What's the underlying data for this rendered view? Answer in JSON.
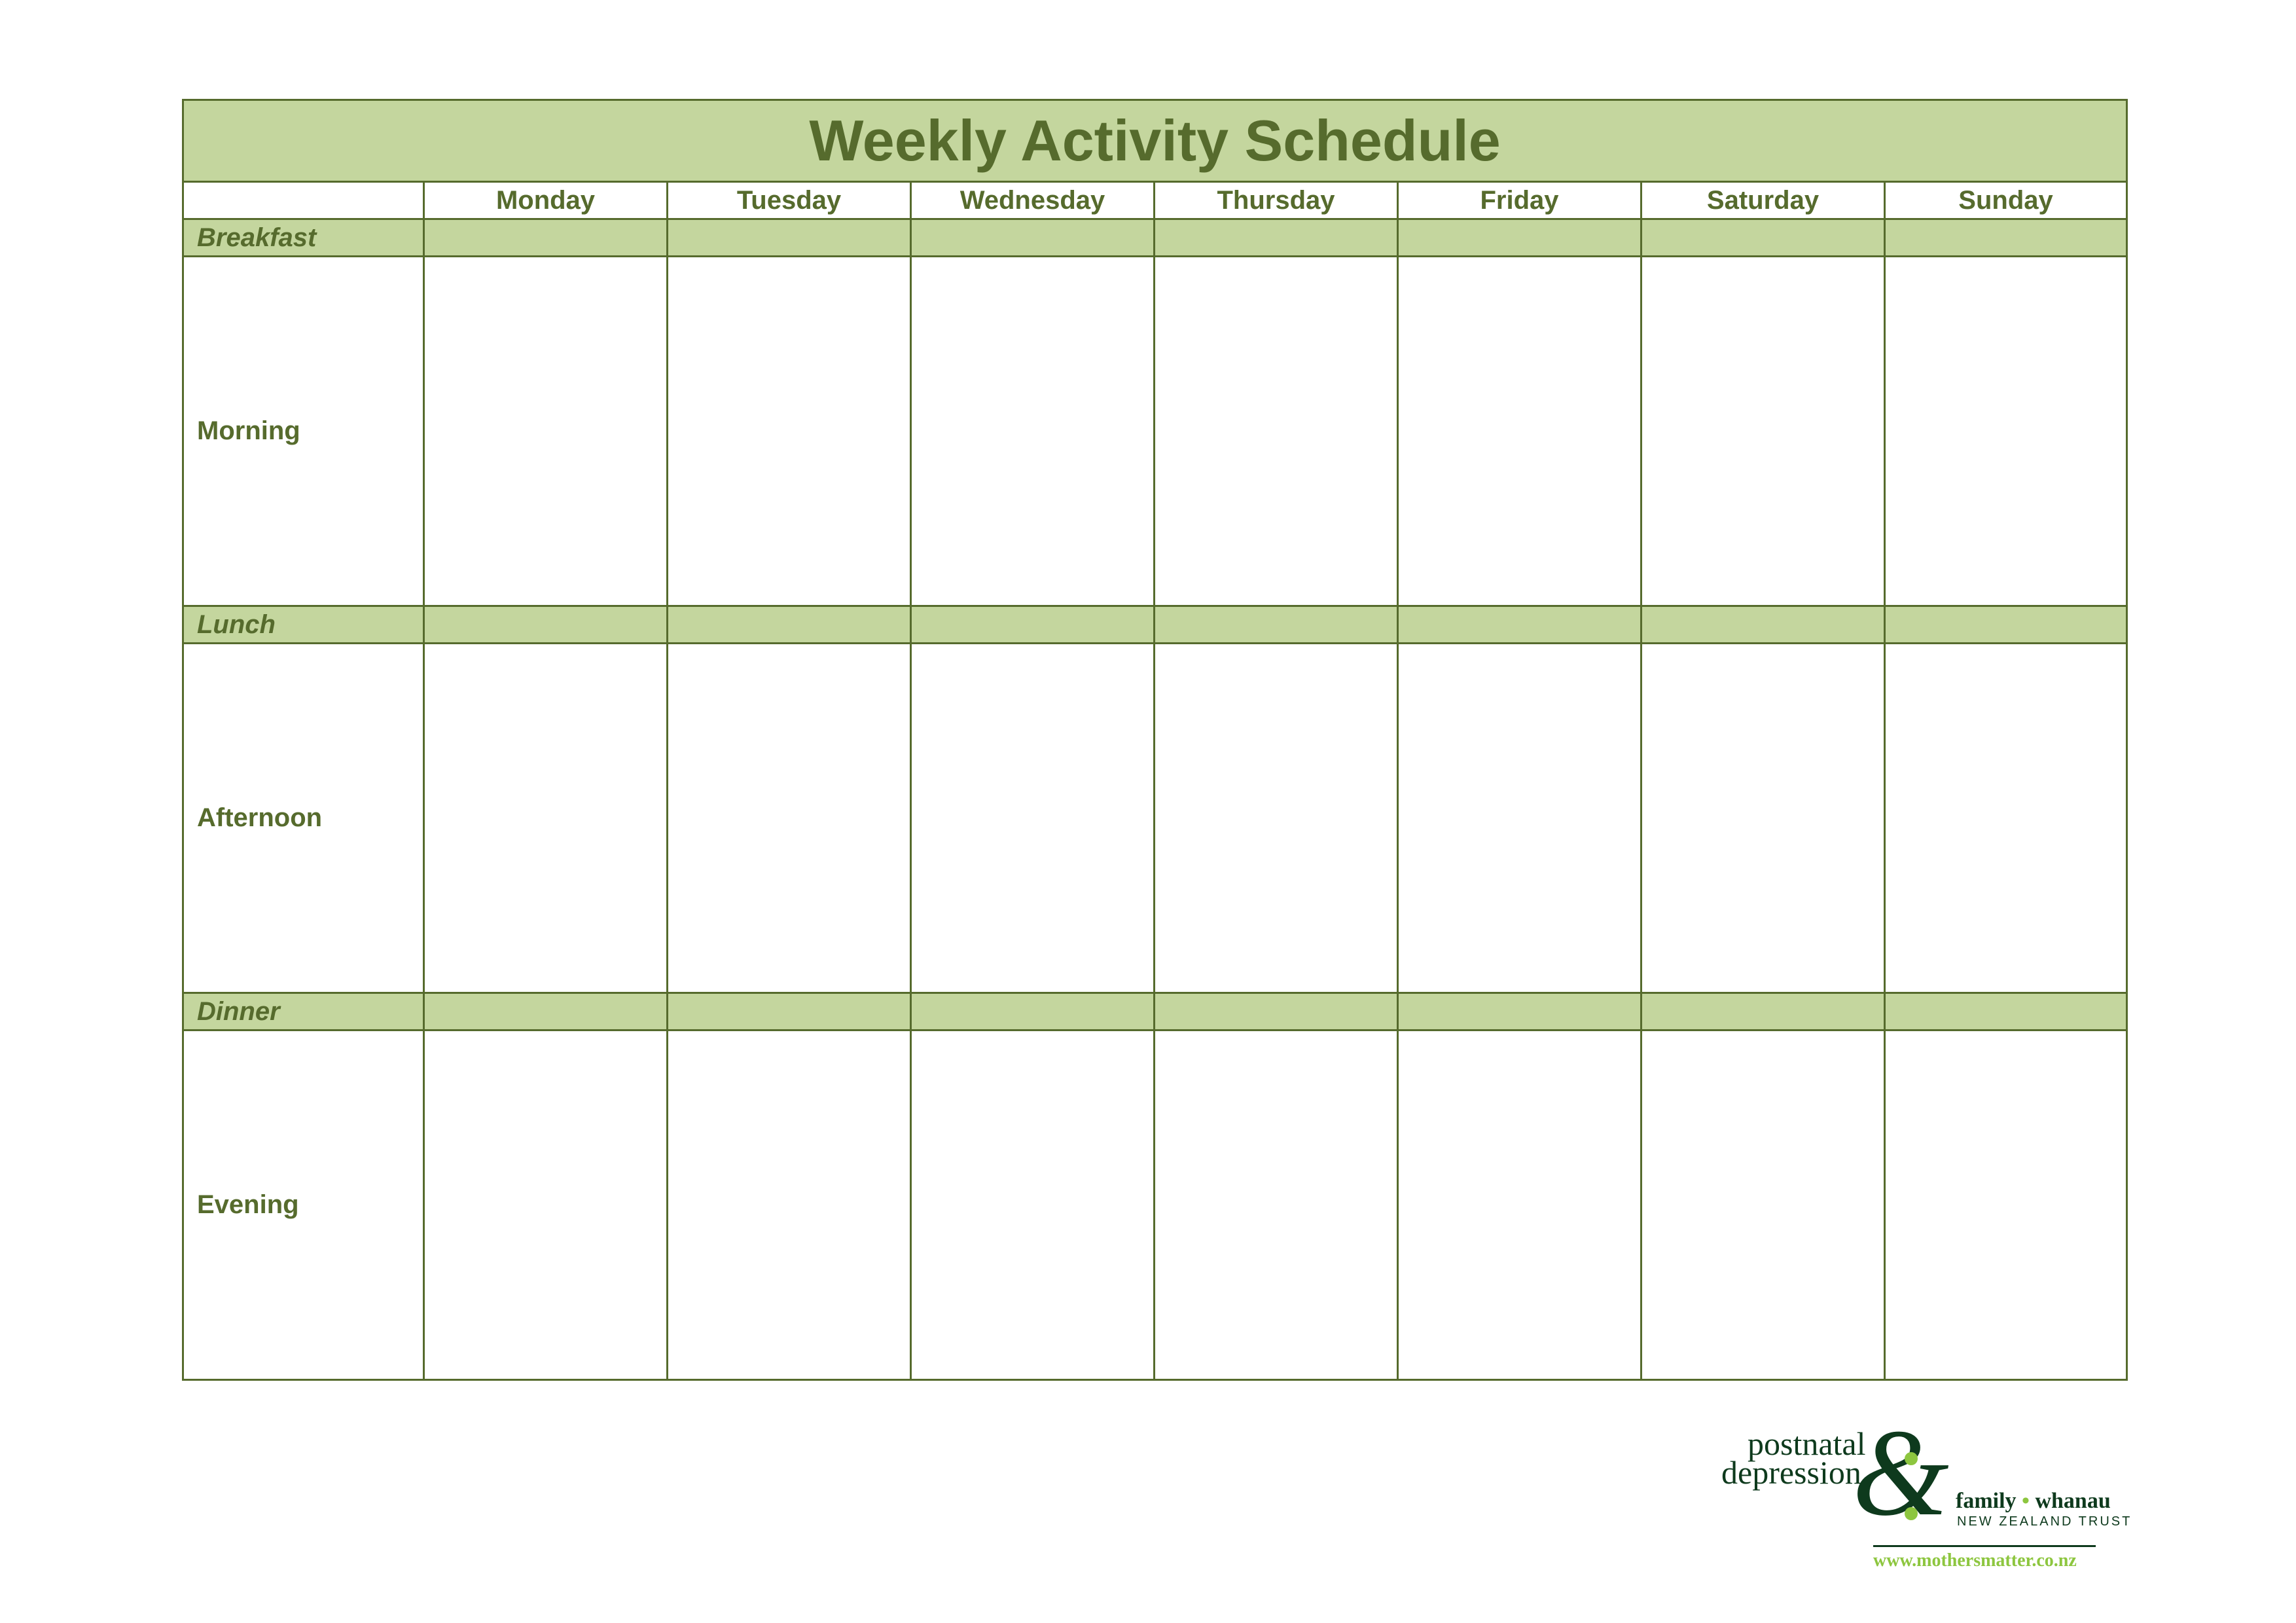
{
  "title": "Weekly Activity Schedule",
  "days": [
    "Monday",
    "Tuesday",
    "Wednesday",
    "Thursday",
    "Friday",
    "Saturday",
    "Sunday"
  ],
  "rows": {
    "breakfast": "Breakfast",
    "morning": "Morning",
    "lunch": "Lunch",
    "afternoon": "Afternoon",
    "dinner": "Dinner",
    "evening": "Evening"
  },
  "logo": {
    "line1": "postnatal",
    "line2": "depression",
    "ampersand": "&",
    "family": "family",
    "separator": "•",
    "whanau": "whanau",
    "trust": "NEW ZEALAND TRUST",
    "url": "www.mothersmatter.co.nz"
  },
  "colors": {
    "header_fill": "#c4d69e",
    "text_green": "#566b2d",
    "logo_dark": "#0e3a1d",
    "logo_accent": "#8dc63f"
  }
}
